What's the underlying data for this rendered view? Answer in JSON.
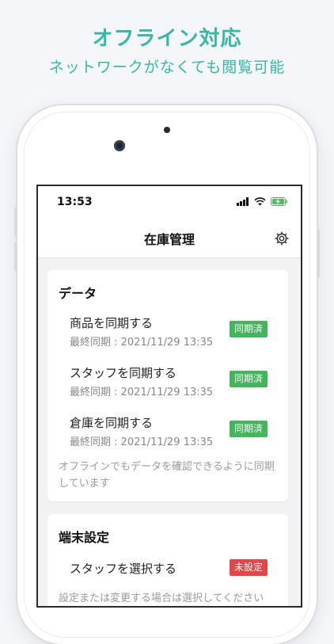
{
  "promo": {
    "title": "オフライン対応",
    "subtitle": "ネットワークがなくても閲覧可能"
  },
  "status_bar": {
    "time": "13:53",
    "icons": [
      "signal-icon",
      "wifi-icon",
      "battery-charging-icon"
    ]
  },
  "nav": {
    "title": "在庫管理",
    "settings_icon": "gear-icon"
  },
  "data_section": {
    "title": "データ",
    "rows": [
      {
        "label": "商品を同期する",
        "sub": "最終同期 : 2021/11/29 13:35",
        "badge": "同期済"
      },
      {
        "label": "スタッフを同期する",
        "sub": "最終同期 : 2021/11/29 13:35",
        "badge": "同期済"
      },
      {
        "label": "倉庫を同期する",
        "sub": "最終同期 : 2021/11/29 13:35",
        "badge": "同期済"
      }
    ],
    "note": "オフラインでもデータを確認できるように同期しています"
  },
  "device_section": {
    "title": "端末設定",
    "rows": [
      {
        "label": "スタッフを選択する",
        "badge": "未設定"
      }
    ],
    "note": "設定または変更する場合は選択してください"
  },
  "colors": {
    "accent": "#35b8a5",
    "synced": "#43b55a",
    "unset": "#e64545"
  }
}
